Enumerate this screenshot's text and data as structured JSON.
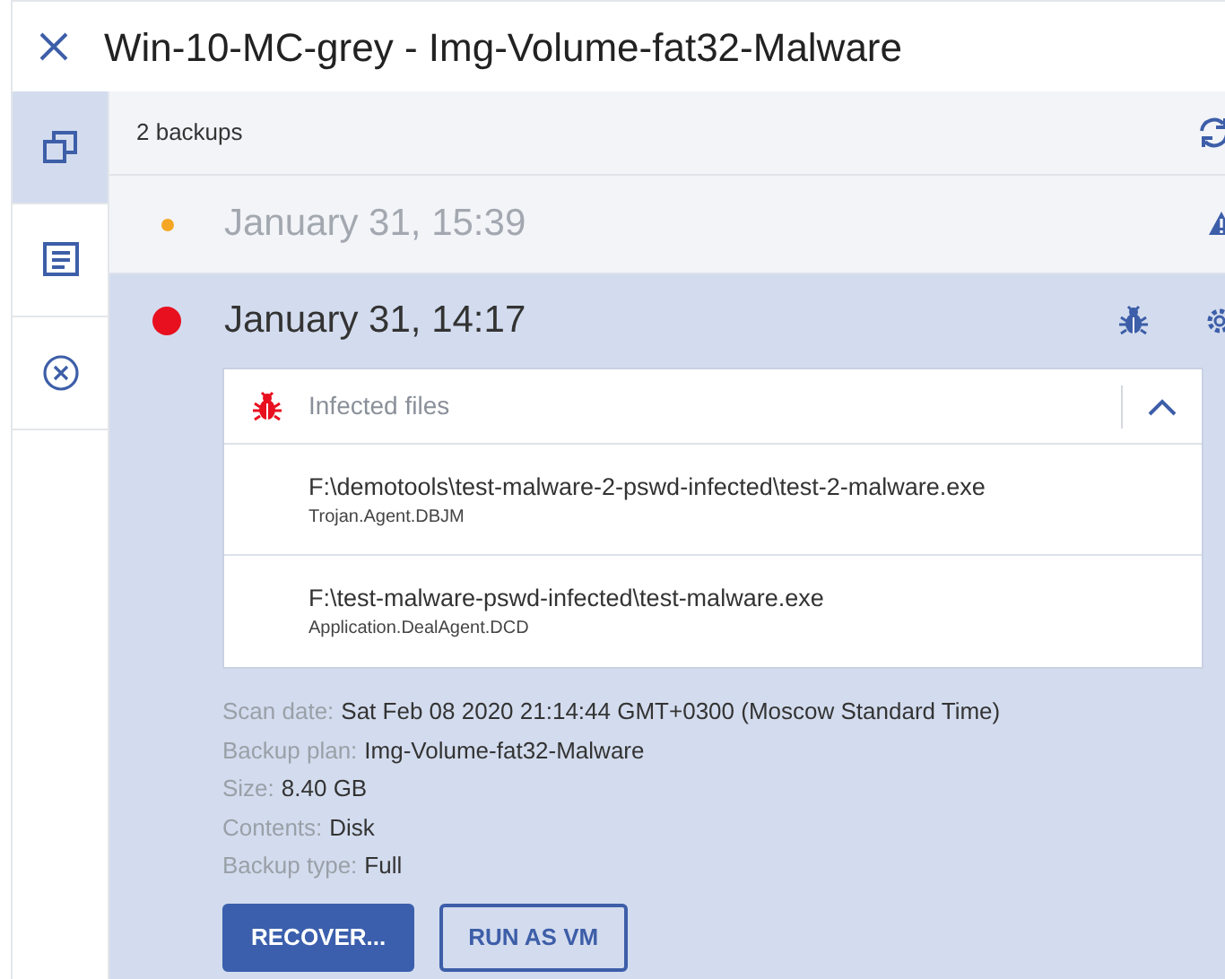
{
  "window": {
    "title": "Win-10-MC-grey - Img-Volume-fat32-Malware"
  },
  "sidebar": {
    "tabs": [
      {
        "kind": "backups",
        "selected": true
      },
      {
        "kind": "activities",
        "selected": false
      },
      {
        "kind": "cancel",
        "selected": false
      }
    ]
  },
  "backups": {
    "count_label": "2 backups",
    "items": [
      {
        "date": "January 31, 15:39",
        "color": "#f5a623",
        "kind": "warning",
        "selected": false
      },
      {
        "date": "January 31, 14:17",
        "color": "#e8101f",
        "kind": "infected",
        "selected": true,
        "infected_files": {
          "title": "Infected files",
          "expanded": true,
          "files": [
            {
              "path": "F:\\demotools\\test-malware-2-pswd-infected\\test-2-malware.exe",
              "threat": "Trojan.Agent.DBJM"
            },
            {
              "path": "F:\\test-malware-pswd-infected\\test-malware.exe",
              "threat": "Application.DealAgent.DCD"
            }
          ]
        },
        "details": [
          {
            "label": "Scan date:",
            "value": "Sat Feb 08 2020 21:14:44 GMT+0300 (Moscow Standard Time)"
          },
          {
            "label": "Backup plan:",
            "value": "Img-Volume-fat32-Malware"
          },
          {
            "label": "Size:",
            "value": "8.40 GB"
          },
          {
            "label": "Contents:",
            "value": "Disk"
          },
          {
            "label": "Backup type:",
            "value": "Full"
          }
        ],
        "buttons": [
          {
            "label": "RECOVER...",
            "kind": "primary"
          },
          {
            "label": "RUN AS VM",
            "kind": "secondary"
          }
        ]
      }
    ]
  }
}
